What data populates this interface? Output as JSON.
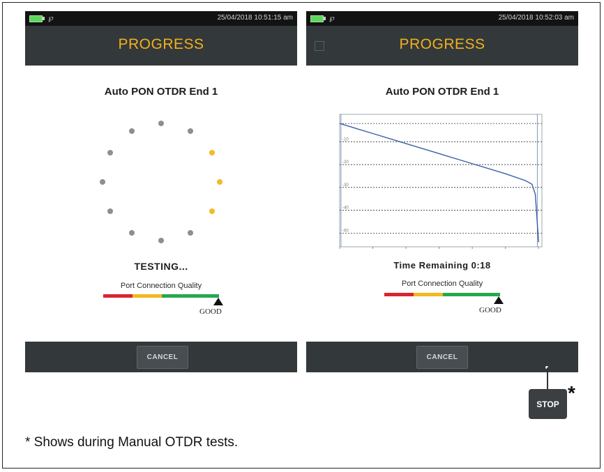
{
  "screens": [
    {
      "statusbar": {
        "datetime": "25/04/2018 10:51:15 am"
      },
      "title": "PROGRESS",
      "test_name": "Auto PON OTDR End 1",
      "status_text": "TESTING...",
      "port_connection_quality": {
        "label": "Port Connection Quality",
        "value": "GOOD"
      },
      "cancel_label": "CANCEL",
      "spinner": {
        "total_dots": 12,
        "highlighted_dots": 3,
        "colors": {
          "inactive": "#8e8e8e",
          "active": "#f3b92a"
        }
      }
    },
    {
      "statusbar": {
        "datetime": "25/04/2018 10:52:03 am"
      },
      "title": "PROGRESS",
      "test_name": "Auto PON OTDR End 1",
      "status_text": "Time Remaining 0:18",
      "port_connection_quality": {
        "label": "Port Connection Quality",
        "value": "GOOD"
      },
      "cancel_label": "CANCEL"
    }
  ],
  "chart_data": {
    "type": "line",
    "title": "",
    "xlabel": "",
    "ylabel": "",
    "x": [
      0,
      0.5,
      1,
      1.5,
      2,
      2.5,
      2.8,
      2.9,
      2.95,
      3.0
    ],
    "series": [
      {
        "values": [
          -1,
          -3.2,
          -5.4,
          -7.6,
          -9.8,
          -12.0,
          -13.5,
          -14.3,
          -16.5,
          -27
        ]
      }
    ],
    "ytick_labels": [
      "-10",
      "-20",
      "-30",
      "-40",
      "-50"
    ],
    "grid": true,
    "colors": {
      "trace": "#3b5fa3",
      "gridline": "#333333"
    }
  },
  "stop_button": {
    "label": "STOP",
    "marker": "*"
  },
  "footnote": "* Shows during Manual OTDR tests.",
  "colors": {
    "accent": "#f2b01e",
    "header_bg": "#33383a",
    "quality_red": "#d7262f",
    "quality_yellow": "#f3b81f",
    "quality_green": "#25a84f"
  }
}
